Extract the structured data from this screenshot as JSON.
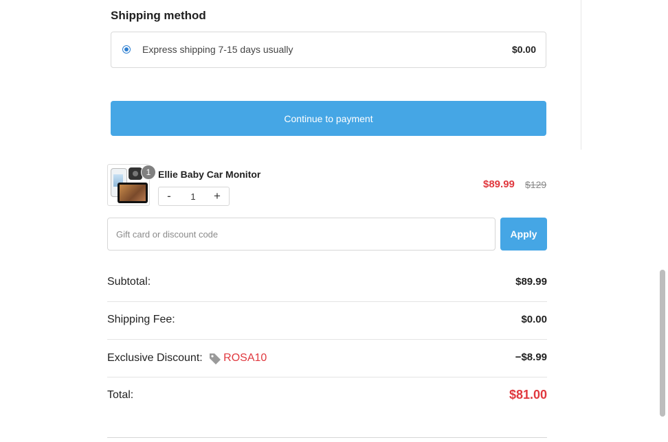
{
  "shipping": {
    "title": "Shipping method",
    "option_label": "Express shipping 7-15 days usually",
    "option_price": "$0.00",
    "selected": true
  },
  "buttons": {
    "continue_label": "Continue to payment",
    "apply_label": "Apply"
  },
  "cart_item": {
    "name": "Ellie Baby Car Monitor",
    "quantity_badge": "1",
    "quantity": "1",
    "decrement": "-",
    "increment": "+",
    "sale_price": "$89.99",
    "original_price": "$129"
  },
  "discount": {
    "placeholder": "Gift card or discount code"
  },
  "summary": {
    "subtotal_label": "Subtotal:",
    "subtotal_value": "$89.99",
    "shipping_label": "Shipping Fee:",
    "shipping_value": "$0.00",
    "discount_label": "Exclusive Discount:",
    "discount_code": "ROSA10",
    "discount_value": "−$8.99",
    "total_label": "Total:",
    "total_value": "$81.00"
  },
  "colors": {
    "accent_blue": "#45a6e5",
    "price_red": "#e0383e"
  },
  "icons": [
    "tag-icon",
    "radio-selected-icon",
    "minus-icon",
    "plus-icon"
  ]
}
